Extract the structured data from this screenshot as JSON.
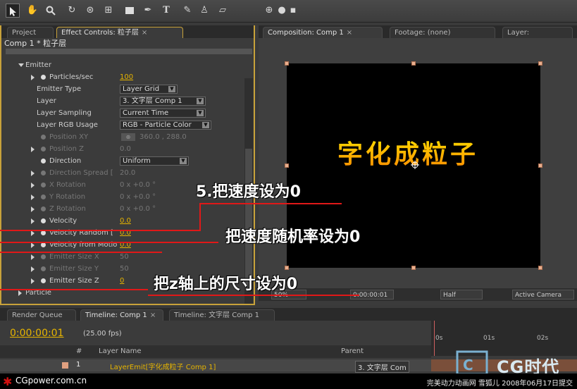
{
  "toolbar": {
    "icons": [
      "selection-arrow-icon",
      "hand-icon",
      "zoom-icon",
      "rotate-icon",
      "orbit-camera-icon",
      "pan-behind-icon",
      "rectangle-mask-icon",
      "pen-icon",
      "type-icon",
      "brush-icon",
      "clone-stamp-icon",
      "eraser-icon",
      "axis-local-icon",
      "axis-world-icon",
      "axis-view-icon"
    ],
    "type_glyph": "T"
  },
  "effect_panel": {
    "tabs": {
      "project": "Project",
      "effect_controls": "Effect Controls: 粒子层"
    },
    "header": "Comp 1 * 粒子层",
    "rows": [
      {
        "label": "Emitter",
        "kind": "group"
      },
      {
        "label": "Particles/sec",
        "value": "100",
        "kind": "num"
      },
      {
        "label": "Emitter Type",
        "value": "Layer Grid",
        "kind": "dd"
      },
      {
        "label": "Layer",
        "value": "3. 文字层 Comp 1",
        "kind": "dd"
      },
      {
        "label": "Layer Sampling",
        "value": "Current Time",
        "kind": "dd"
      },
      {
        "label": "Layer RGB Usage",
        "value": "RGB - Particle Color",
        "kind": "dd"
      },
      {
        "label": "Position XY",
        "value": "360.0 , 288.0",
        "kind": "dim"
      },
      {
        "label": "Position Z",
        "value": "0.0",
        "kind": "dim"
      },
      {
        "label": "Direction",
        "value": "Uniform",
        "kind": "dd"
      },
      {
        "label": "Direction Spread [",
        "value": "20.0",
        "kind": "dim"
      },
      {
        "label": "X Rotation",
        "value": "0 x +0.0 °",
        "kind": "dim"
      },
      {
        "label": "Y Rotation",
        "value": "0 x +0.0 °",
        "kind": "dim"
      },
      {
        "label": "Z Rotation",
        "value": "0 x +0.0 °",
        "kind": "dim"
      },
      {
        "label": "Velocity",
        "value": "0.0",
        "kind": "num"
      },
      {
        "label": "Velocity Random [",
        "value": "0.0",
        "kind": "num"
      },
      {
        "label": "Velocity from Motio",
        "value": "0.0",
        "kind": "num"
      },
      {
        "label": "Emitter Size X",
        "value": "50",
        "kind": "dim"
      },
      {
        "label": "Emitter Size Y",
        "value": "50",
        "kind": "dim"
      },
      {
        "label": "Emitter Size Z",
        "value": "0",
        "kind": "num"
      },
      {
        "label": "Particle",
        "kind": "group"
      }
    ]
  },
  "comp_panel": {
    "tabs": {
      "composition": "Composition: Comp 1",
      "footage": "Footage: (none)",
      "layer": "Layer:"
    },
    "canvas_text": "字化成粒子",
    "viewer_bar": {
      "zoom": "50%",
      "time": "0:00:00:01",
      "resolution": "Half",
      "camera": "Active Camera"
    }
  },
  "timeline": {
    "tabs": {
      "render_queue": "Render Queue",
      "timeline_comp": "Timeline: Comp 1",
      "timeline_text": "Timeline: 文字层 Comp 1"
    },
    "current_time": "0:00:00:01",
    "fps": "(25.00 fps)",
    "headers": {
      "num": "#",
      "layer_name": "Layer Name",
      "parent": "Parent"
    },
    "ruler_ticks": [
      "0s",
      "01s",
      "02s"
    ],
    "layer": {
      "index": "1",
      "name": "LayerEmit[字化成粒子 Comp 1]",
      "parent": "3. 文字层 Com"
    }
  },
  "annotations": {
    "a1": "5.把速度设为0",
    "a2": "把速度随机率设为0",
    "a3": "把z轴上的尺寸设为0"
  },
  "footer": {
    "site": "CGpower.com.cn",
    "credit": "完美动力动画网 雪狐儿 2008年06月17日提交",
    "logo": "CG时代"
  },
  "colors": {
    "accent": "#e6b400",
    "annotation_line": "#e01818",
    "panel_border": "#c8a23a"
  }
}
